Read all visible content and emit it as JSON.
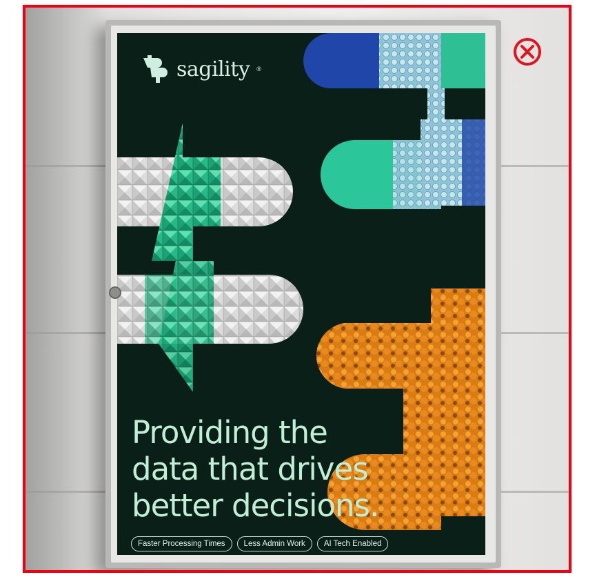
{
  "ad": {
    "brand": "sagility",
    "brand_mark": "®",
    "headline_lines": [
      "Providing the",
      "data that drives",
      "better decisions."
    ],
    "tags": [
      "Faster Processing Times",
      "Less Admin Work",
      "AI Tech Enabled"
    ]
  },
  "controls": {
    "close_icon": "close-icon"
  },
  "colors": {
    "frame_border": "#f00010",
    "poster_bg": "#0b1f19",
    "headline": "#bff0d6",
    "close_icon": "#e0141e"
  }
}
